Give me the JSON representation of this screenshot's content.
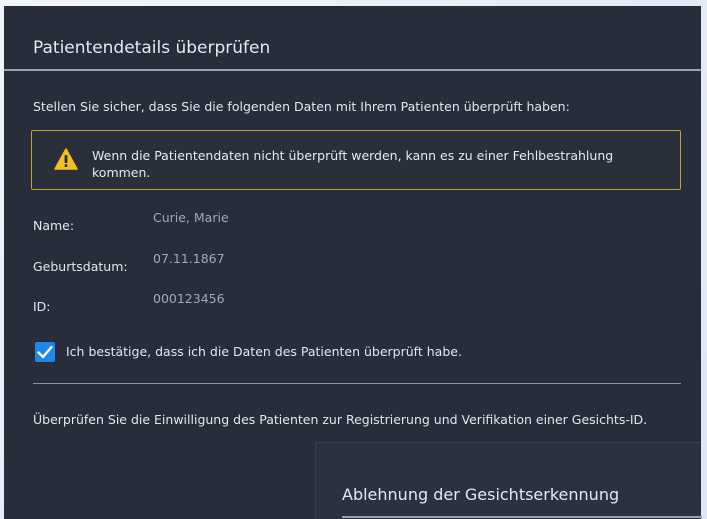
{
  "dialog": {
    "title": "Patientendetails überprüfen",
    "intro": "Stellen Sie sicher, dass Sie die folgenden Daten mit Ihrem Patienten überprüft haben:",
    "warning": {
      "icon": "warning-icon",
      "text": "Wenn die Patientendaten nicht überprüft werden, kann es zu einer Fehlbestrahlung kommen."
    },
    "fields": [
      {
        "label": "Name:",
        "value": "Curie, Marie"
      },
      {
        "label": "Geburtsdatum:",
        "value": "07.11.1867"
      },
      {
        "label": "ID:",
        "value": "000123456"
      }
    ],
    "confirm": {
      "checked": true,
      "label": "Ich bestätige, dass ich die Daten des Patienten überprüft habe."
    },
    "consent_text": "Überprüfen Sie die Einwilligung des Patienten zur Registrierung und Verifikation einer Gesichts-ID."
  },
  "subpanel": {
    "title": "Ablehnung der Gesichtserkennung"
  },
  "colors": {
    "dialog_bg": "#272d3b",
    "warning_border": "#c8a32a",
    "warning_icon": "#f2c21b",
    "checkbox": "#1e88e5",
    "value_text": "#9aa9bf"
  }
}
